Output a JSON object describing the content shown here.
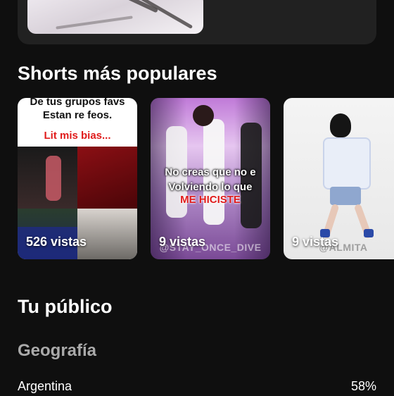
{
  "shorts_section": {
    "title": "Shorts más populares",
    "items": [
      {
        "views": "526 vistas",
        "captions": [
          "De tus grupos favs",
          "Estan re feos.",
          "Lit mis bias..."
        ]
      },
      {
        "views": "9 vistas",
        "captions": [
          "No creas que no e",
          "Volviendo lo que",
          "ME HICISTE"
        ],
        "watermark": "@STAY_ONCE_DIVE"
      },
      {
        "views": "9 vistas",
        "watermark": "@ALMITA"
      }
    ]
  },
  "audience_section": {
    "title": "Tu público",
    "geography": {
      "title": "Geografía",
      "rows": [
        {
          "country": "Argentina",
          "percent": "58%"
        }
      ]
    }
  }
}
